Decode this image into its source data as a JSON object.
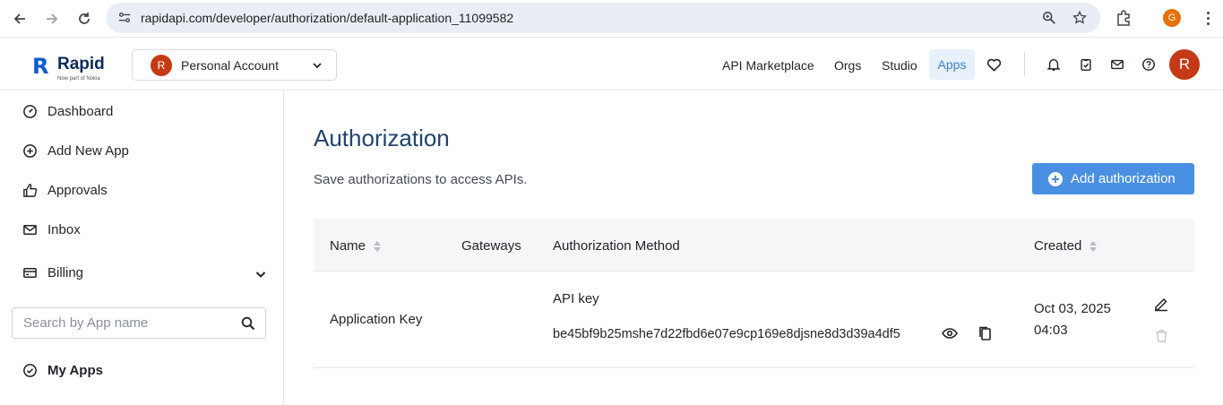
{
  "browser": {
    "url": "rapidapi.com/developer/authorization/default-application_11099582",
    "profile_initial": "G"
  },
  "header": {
    "logo_word": "Rapid",
    "logo_mark": "R",
    "logo_sub": "Now part of Nokia",
    "account_initial": "R",
    "account_name": "Personal Account",
    "nav": [
      "API Marketplace",
      "Orgs",
      "Studio",
      "Apps"
    ],
    "active_tab": "Apps",
    "user_initial": "R"
  },
  "sidebar": {
    "items": [
      {
        "label": "Dashboard",
        "icon": "dashboard-icon"
      },
      {
        "label": "Add New App",
        "icon": "plus-circle-icon"
      },
      {
        "label": "Approvals",
        "icon": "thumbs-up-icon"
      },
      {
        "label": "Inbox",
        "icon": "mail-icon"
      },
      {
        "label": "Billing",
        "icon": "credit-card-icon"
      }
    ],
    "search_placeholder": "Search by App name",
    "my_apps": "My Apps"
  },
  "main": {
    "title": "Authorization",
    "subtitle": "Save authorizations to access APIs.",
    "add_button": "Add authorization",
    "columns": [
      "Name",
      "Gateways",
      "Authorization Method",
      "Created"
    ],
    "rows": [
      {
        "name": "Application Key",
        "gateways": "",
        "method_label": "API key",
        "key": "be45bf9b25mshe7d22fbd6e07e9cp169e8djsne8d3d39a4df5",
        "created_date": "Oct 03, 2025",
        "created_time": "04:03"
      }
    ]
  },
  "colors": {
    "accent": "#4a90e2",
    "title": "#22436e",
    "avatar": "#c53a15",
    "active_tab_bg": "#e7f0fb"
  }
}
